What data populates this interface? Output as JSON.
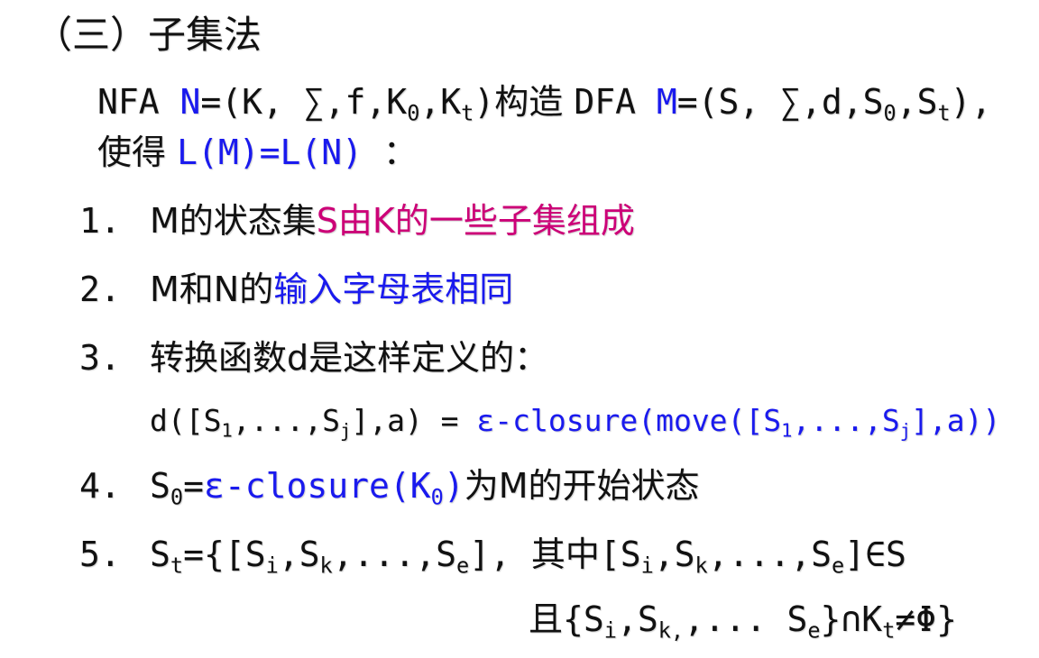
{
  "heading": "（三）子集法",
  "intro": {
    "nfa_prefix": "NFA ",
    "nfa_name": "N",
    "nfa_tuple_open": "=(K, ∑,f,K",
    "nfa_k0_sub": "0",
    "nfa_comma": ",K",
    "nfa_kt_sub": "t",
    "nfa_close": ")",
    "construct": "构造 ",
    "dfa_prefix": "DFA ",
    "dfa_name": "M",
    "dfa_tuple_open": "=(S, ∑,d,S",
    "dfa_s0_sub": "0",
    "dfa_comma": ",S",
    "dfa_st_sub": "t",
    "dfa_close": "),",
    "such_that": "使得 ",
    "equation": "L(M)=L(N)",
    "colon": " ："
  },
  "items": [
    {
      "number": "1.",
      "text_a": "M的状态集",
      "text_b": "S由K的一些子集组成"
    },
    {
      "number": "2.",
      "text_a": "M和N的",
      "text_b": "输入字母表相同"
    },
    {
      "number": "3.",
      "text_a": "转换函数d是这样定义的："
    },
    {
      "number": "4.",
      "s0_base": "S",
      "s0_sub": "0",
      "eq": "=",
      "closure": "ε-closure(K",
      "closure_sub": "0",
      "closure_close": ")",
      "tail": "为M的开始状态"
    },
    {
      "number": "5."
    }
  ],
  "formula3": {
    "lhs_a": "d([S",
    "lhs_sub1": "1",
    "lhs_b": ",...,S",
    "lhs_subj": "j",
    "lhs_c": "],a) = ",
    "rhs_a": "ε-closure(move([S",
    "rhs_sub1": "1",
    "rhs_b": ",...,S",
    "rhs_subj": "j",
    "rhs_c": "],a))"
  },
  "item5": {
    "st_base": "S",
    "st_sub": "t",
    "a": "={[S",
    "sub_i": "i",
    "b": ",S",
    "sub_k": "k",
    "c": ",...,S",
    "sub_e": "e",
    "d": "], 其中[S",
    "sub_i2": "i",
    "e": ",S",
    "sub_k2": "k",
    "f": ",...,S",
    "sub_e2": "e",
    "g": "]∈S"
  },
  "item5_cond": {
    "a": "且{S",
    "sub_i": "i",
    "b": ",S",
    "sub_k": "k,",
    "c": ",... S",
    "sub_e": "e",
    "d": "}∩K",
    "sub_t": "t",
    "e": "≠Φ}"
  },
  "colors": {
    "text": "#111111",
    "blue": "#1a1aee",
    "magenta": "#cc0077",
    "background": "#ffffff"
  }
}
